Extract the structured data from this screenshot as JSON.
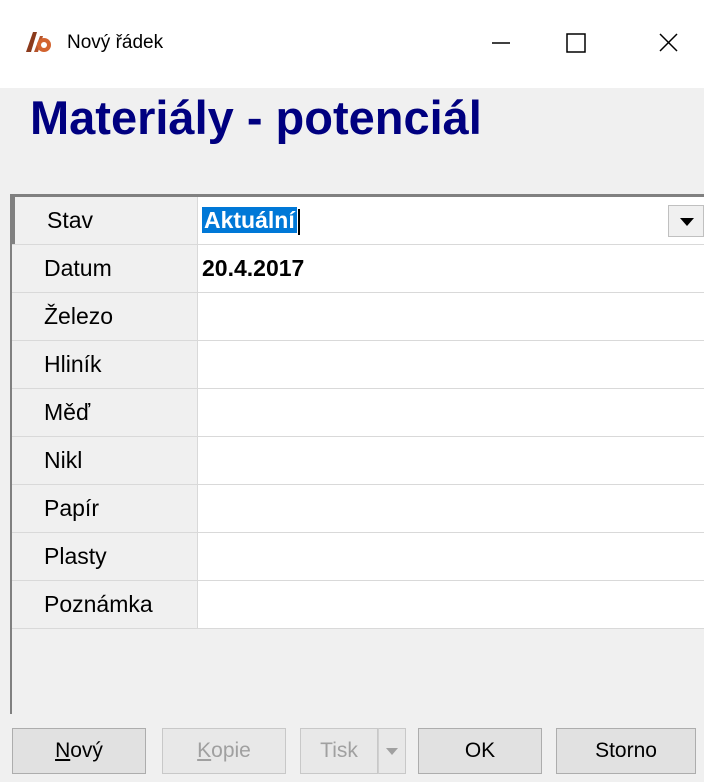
{
  "window": {
    "title": "Nový řádek",
    "icon": "app-logo-icon"
  },
  "header": {
    "title": "Materiály - potenciál"
  },
  "form": {
    "rows": [
      {
        "label": "Stav",
        "value": "Aktuální"
      },
      {
        "label": "Datum",
        "value": "20.4.2017"
      },
      {
        "label": "Železo",
        "value": ""
      },
      {
        "label": "Hliník",
        "value": ""
      },
      {
        "label": "Měď",
        "value": ""
      },
      {
        "label": "Nikl",
        "value": ""
      },
      {
        "label": "Papír",
        "value": ""
      },
      {
        "label": "Plasty",
        "value": ""
      },
      {
        "label": "Poznámka",
        "value": ""
      }
    ]
  },
  "buttons": {
    "new_first": "N",
    "new_rest": "ový",
    "copy_first": "K",
    "copy_rest": "opie",
    "print": "Tisk",
    "ok": "OK",
    "cancel": "Storno"
  },
  "colors": {
    "title_text": "#000080",
    "selection": "#0078d7"
  }
}
